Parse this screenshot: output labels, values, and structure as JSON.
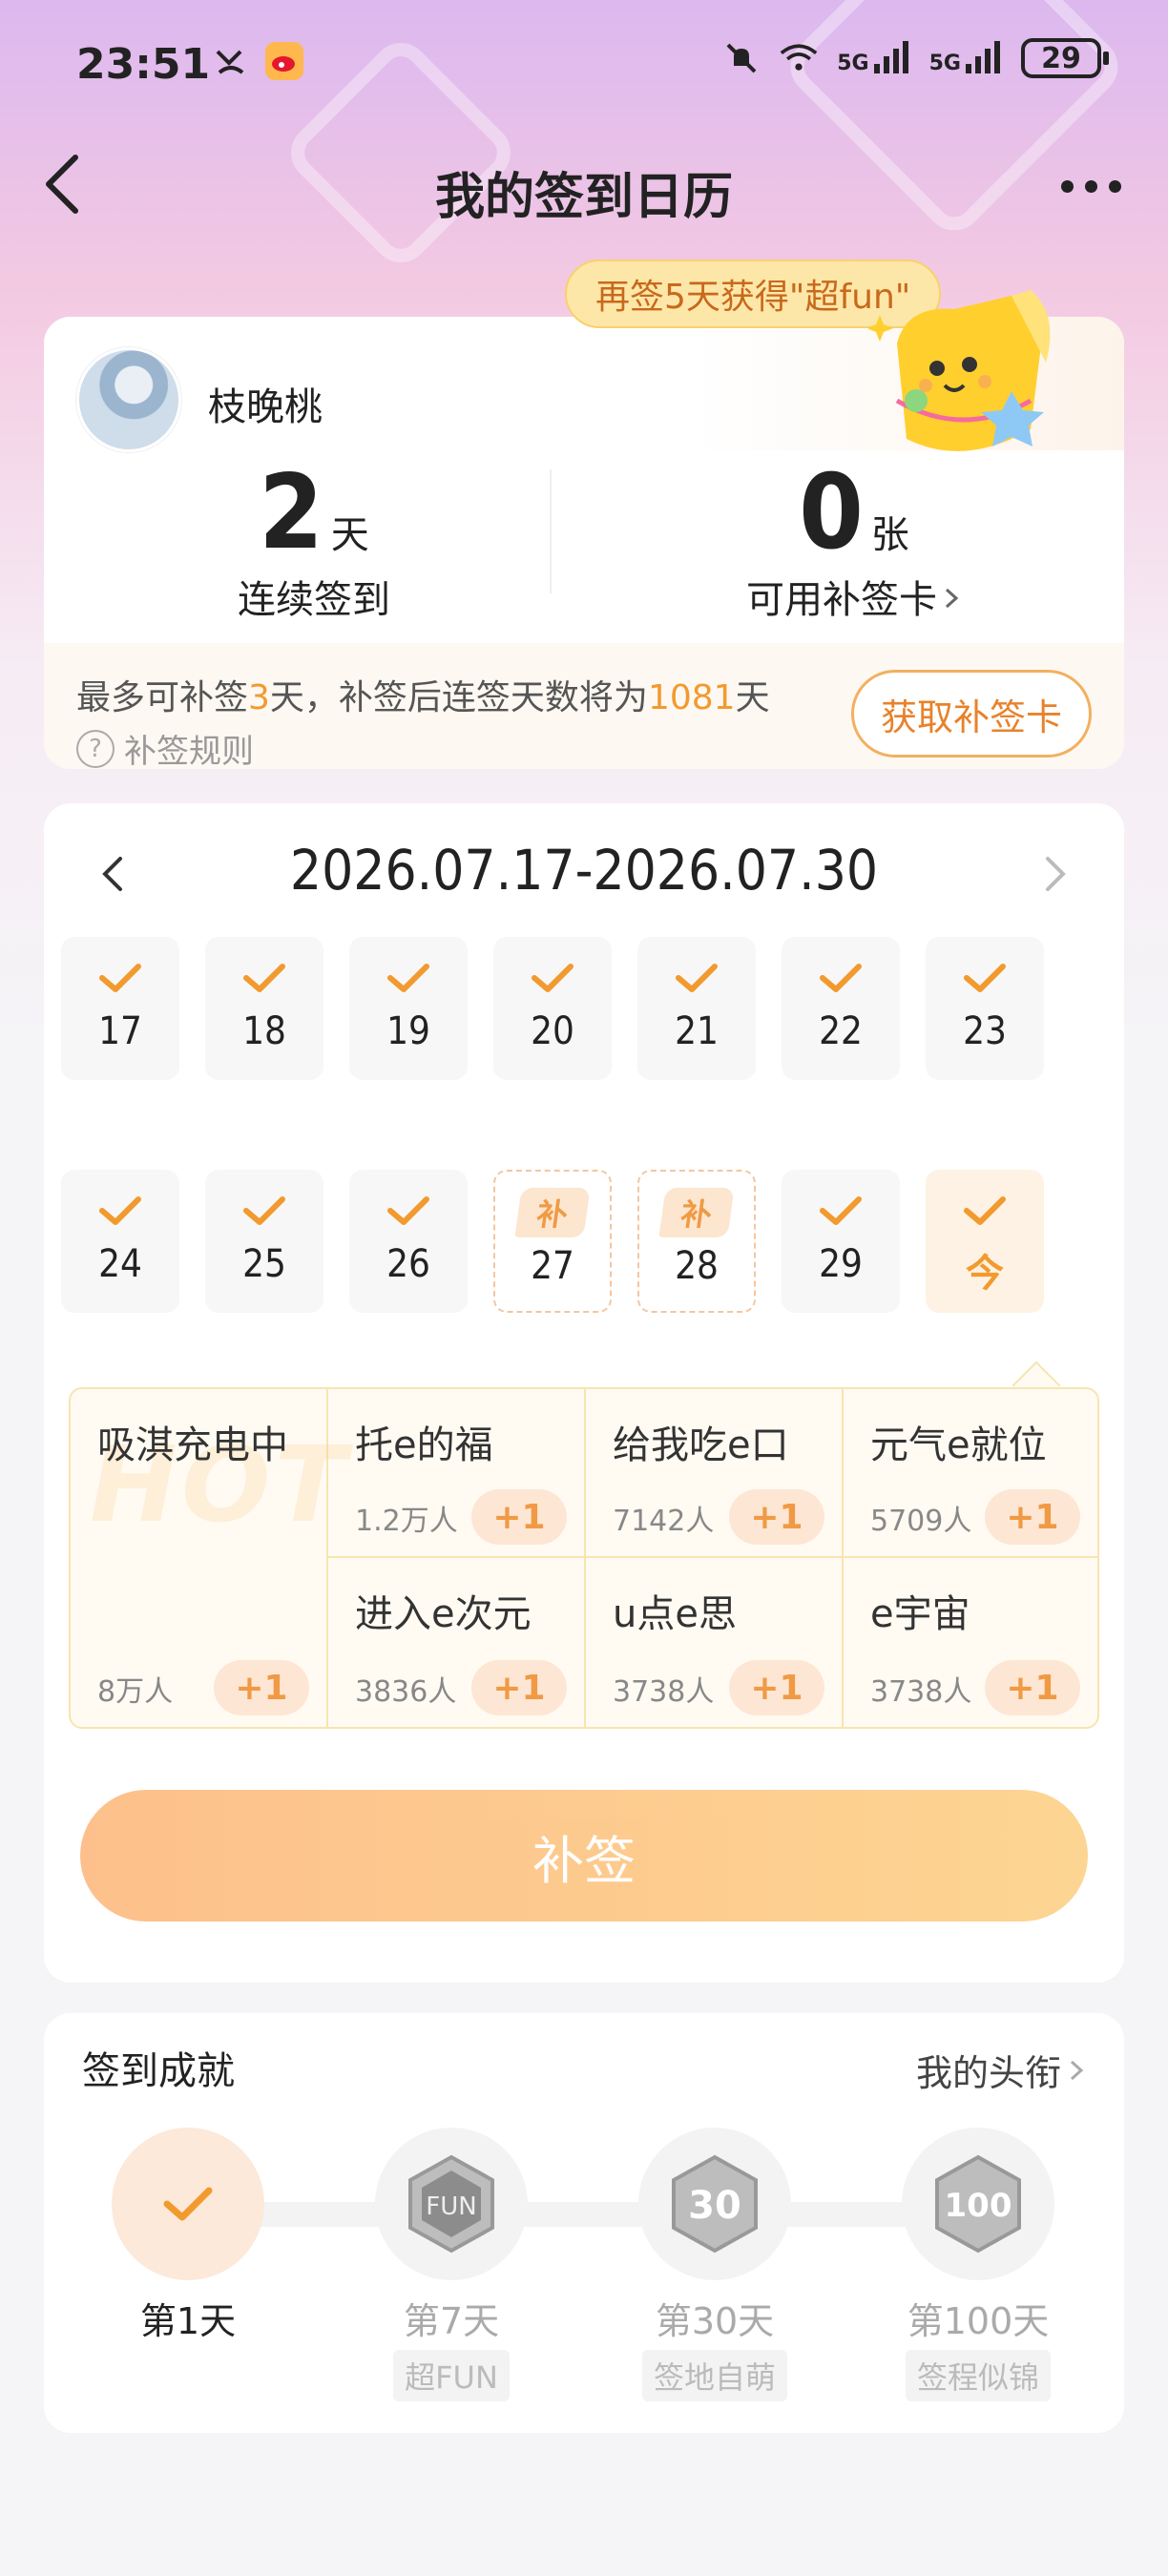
{
  "status_bar": {
    "time": "23:51",
    "battery": "29",
    "sig1": "5G",
    "sig2": "5G"
  },
  "nav": {
    "title": "我的签到日历"
  },
  "profile": {
    "username": "枝晚桃",
    "promo": "再签5天获得\"超fun\"",
    "streak_num": "2",
    "streak_unit": "天",
    "streak_label": "连续签到",
    "card_num": "0",
    "card_unit": "张",
    "card_label": "可用补签卡",
    "makeup_pre": "最多可补签",
    "makeup_days": "3",
    "makeup_mid": "天，补签后连签天数将为",
    "makeup_total": "1081",
    "makeup_post": "天",
    "rules_label": "补签规则",
    "get_card_label": "获取补签卡"
  },
  "calendar": {
    "range": "2026.07.17-2026.07.30",
    "makeup_badge": "补",
    "days": [
      {
        "label": "17",
        "state": "checked"
      },
      {
        "label": "18",
        "state": "checked"
      },
      {
        "label": "19",
        "state": "checked"
      },
      {
        "label": "20",
        "state": "checked"
      },
      {
        "label": "21",
        "state": "checked"
      },
      {
        "label": "22",
        "state": "checked"
      },
      {
        "label": "23",
        "state": "checked"
      },
      {
        "label": "24",
        "state": "checked"
      },
      {
        "label": "25",
        "state": "checked"
      },
      {
        "label": "26",
        "state": "checked"
      },
      {
        "label": "27",
        "state": "makeup"
      },
      {
        "label": "28",
        "state": "makeup"
      },
      {
        "label": "29",
        "state": "checked"
      },
      {
        "label": "今",
        "state": "today"
      }
    ]
  },
  "topics": {
    "main": {
      "name": "吸淇充电中",
      "count": "8万人",
      "plus": "+1"
    },
    "items": [
      {
        "name": "托e的福",
        "count": "1.2万人",
        "plus": "+1"
      },
      {
        "name": "给我吃e口",
        "count": "7142人",
        "plus": "+1"
      },
      {
        "name": "元气e就位",
        "count": "5709人",
        "plus": "+1"
      },
      {
        "name": "进入e次元",
        "count": "3836人",
        "plus": "+1"
      },
      {
        "name": "u点e思",
        "count": "3738人",
        "plus": "+1"
      },
      {
        "name": "e宇宙",
        "count": "3738人",
        "plus": "+1"
      }
    ]
  },
  "makeup_button": "补签",
  "achievements": {
    "title": "签到成就",
    "link": "我的头衔",
    "badges": [
      {
        "day": "第1天",
        "tag": "",
        "done": true
      },
      {
        "day": "第7天",
        "tag": "超FUN",
        "done": false
      },
      {
        "day": "第30天",
        "tag": "签地自萌",
        "done": false
      },
      {
        "day": "第100天",
        "tag": "签程似锦",
        "done": false
      }
    ]
  },
  "colors": {
    "accent": "#f29a2e",
    "promo_bg": "#fde7a8",
    "button_gradient": [
      "#fdbd86",
      "#fdd38c"
    ]
  }
}
